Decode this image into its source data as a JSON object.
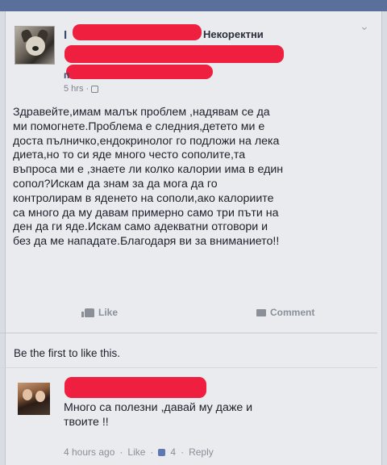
{
  "post": {
    "author_initial": "I",
    "group": "Некоректни",
    "second_initial": "п",
    "time": "5 hrs",
    "text_lines": [
      "Здравейте,имам малък проблем ,надявам се да",
      "ми помогнете.Проблема е следния,детето ми е",
      "доста пълничко,ендокринолог го подложи на лека",
      "диета,но то си яде много често сополите,та",
      "въпроса ми е ,знаете ли колко калории има в един",
      "сопол?Искам да знам за да мога да го",
      "контролирам в яденето на сополи,ако калориите",
      "са много да му давам примерно само три пъти на",
      "ден да ги яде.Искам само адекватни отговори и",
      "без да ме нападате.Благодаря ви за вниманието!!"
    ]
  },
  "actions": {
    "like_label": "Like",
    "comment_label": "Comment"
  },
  "likes_summary": "Be the first to like this.",
  "comment": {
    "text_line1": "Много са полезни ,давай му даже и",
    "text_line2": "твоите !!",
    "time": "4 hours ago",
    "like_label": "Like",
    "like_count": "4",
    "reply_label": "Reply",
    "separator": "·"
  },
  "colors": {
    "redaction": "#ee1f3f",
    "background": "#e9ebef",
    "header_strip": "#5b6f9b"
  },
  "icons": {
    "chevron": "chevron-down-icon",
    "globe": "globe-icon",
    "like": "thumbs-up-icon",
    "comment": "comment-bubble-icon"
  }
}
